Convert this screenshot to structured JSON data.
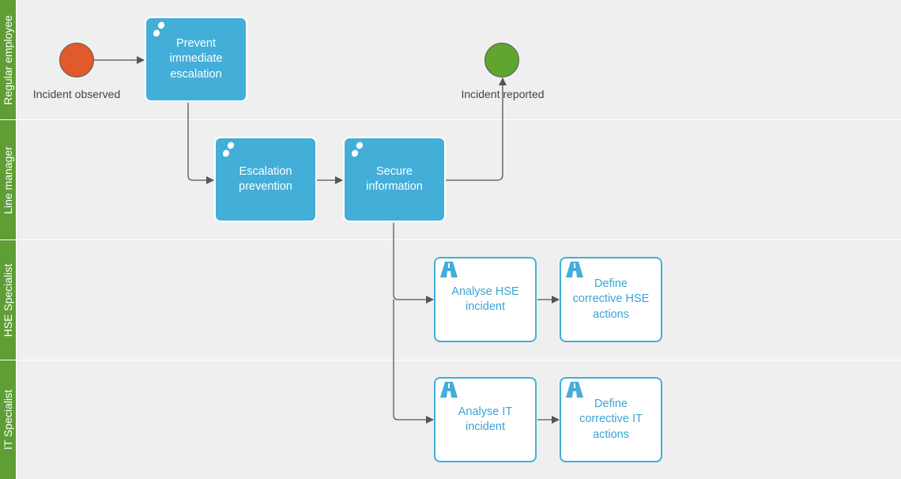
{
  "lanes": [
    {
      "label": "Regular employee"
    },
    {
      "label": "Line manager"
    },
    {
      "label": "HSE Specialist"
    },
    {
      "label": "IT Specialist"
    }
  ],
  "events": {
    "start": {
      "label": "Incident observed",
      "color": "#e05a2b"
    },
    "end": {
      "label": "Incident reported",
      "color": "#5fa52f"
    }
  },
  "tasks": [
    {
      "label": "Prevent immediate escalation",
      "type": "manual",
      "icon": "footsteps-icon"
    },
    {
      "label": "Escalation prevention",
      "type": "manual",
      "icon": "footsteps-icon"
    },
    {
      "label": "Secure information",
      "type": "manual",
      "icon": "footsteps-icon"
    },
    {
      "label": "Analyse HSE incident",
      "type": "user",
      "icon": "road-icon"
    },
    {
      "label": "Define corrective HSE actions",
      "type": "user",
      "icon": "road-icon"
    },
    {
      "label": "Analyse IT incident",
      "type": "user",
      "icon": "road-icon"
    },
    {
      "label": "Define corrective IT actions",
      "type": "user",
      "icon": "road-icon"
    }
  ],
  "colors": {
    "lane_header": "#5e9e35",
    "manual_task": "#43aed8",
    "user_task_border": "#43aed8"
  }
}
